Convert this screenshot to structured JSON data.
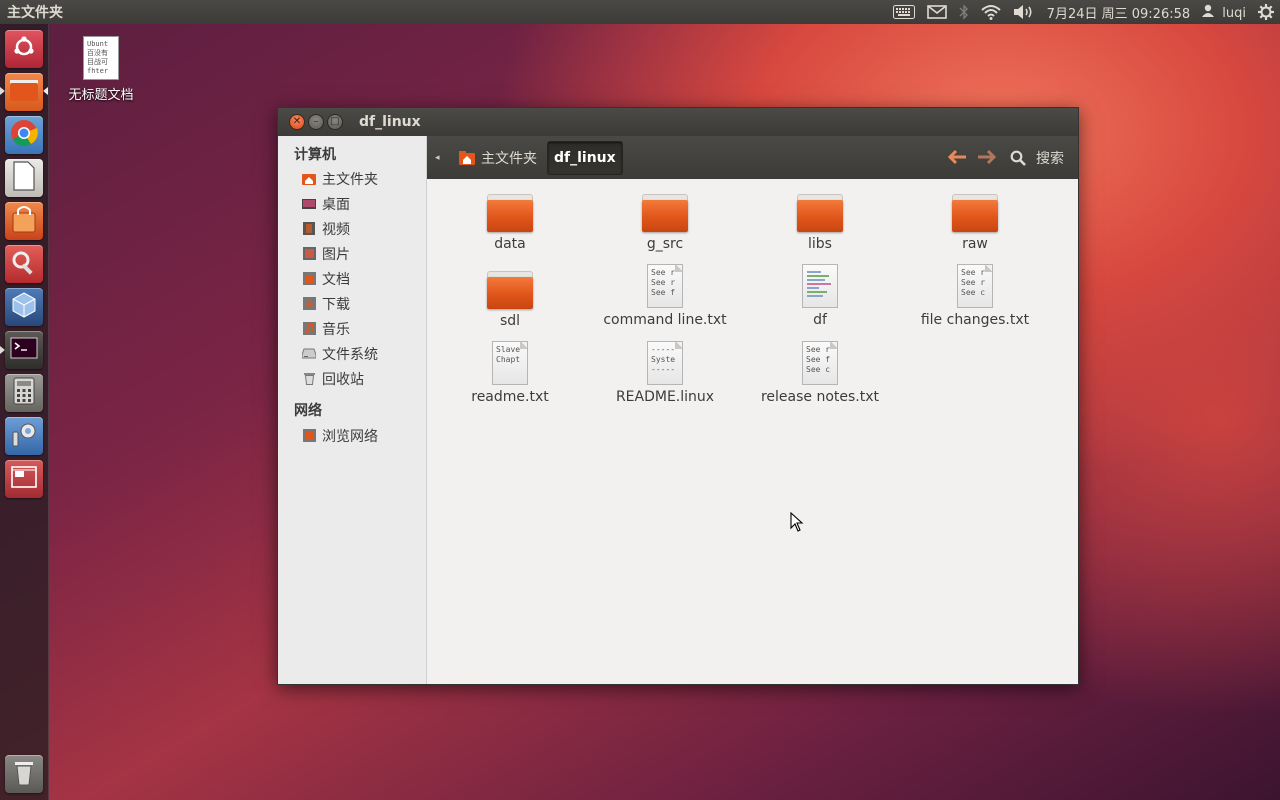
{
  "panel": {
    "app_title": "主文件夹",
    "clock": "7月24日 周三 09:26:58",
    "user": "luqi"
  },
  "desktop": {
    "icon_label": "无标题文档",
    "icon_preview": [
      "Ubunt",
      "百没有",
      "目战可",
      "fhter"
    ]
  },
  "window": {
    "title": "df_linux",
    "sidebar": {
      "computer_header": "计算机",
      "computer_items": [
        {
          "label": "主文件夹",
          "icon": "home-folder-icon"
        },
        {
          "label": "桌面",
          "icon": "desktop-icon"
        },
        {
          "label": "视频",
          "icon": "video-icon"
        },
        {
          "label": "图片",
          "icon": "pictures-icon"
        },
        {
          "label": "文档",
          "icon": "documents-icon"
        },
        {
          "label": "下载",
          "icon": "downloads-icon"
        },
        {
          "label": "音乐",
          "icon": "music-icon"
        },
        {
          "label": "文件系统",
          "icon": "drive-icon"
        },
        {
          "label": "回收站",
          "icon": "trash-icon"
        }
      ],
      "network_header": "网络",
      "network_items": [
        {
          "label": "浏览网络",
          "icon": "network-icon"
        }
      ]
    },
    "toolbar": {
      "crumb_home": "主文件夹",
      "crumb_current": "df_linux",
      "search_label": "搜索"
    },
    "files": [
      {
        "name": "data",
        "type": "folder"
      },
      {
        "name": "g_src",
        "type": "folder"
      },
      {
        "name": "libs",
        "type": "folder"
      },
      {
        "name": "raw",
        "type": "folder"
      },
      {
        "name": "sdl",
        "type": "folder"
      },
      {
        "name": "command line.txt",
        "type": "text",
        "preview": [
          "See r",
          "See r",
          "See f"
        ]
      },
      {
        "name": "df",
        "type": "script"
      },
      {
        "name": "file changes.txt",
        "type": "text",
        "preview": [
          "See r",
          "See r",
          "See c"
        ]
      },
      {
        "name": "readme.txt",
        "type": "text",
        "preview": [
          "Slave",
          "Chapt",
          ""
        ]
      },
      {
        "name": "README.linux",
        "type": "text",
        "preview": [
          "-----",
          "Syste",
          "-----"
        ]
      },
      {
        "name": "release notes.txt",
        "type": "text",
        "preview": [
          "See r",
          "See f",
          "See c"
        ]
      }
    ]
  },
  "colors": {
    "accent": "#dd4814",
    "folder_orange": "#e0551a",
    "panel_bg": "#3c3b37",
    "window_bg": "#f2f1f0"
  }
}
